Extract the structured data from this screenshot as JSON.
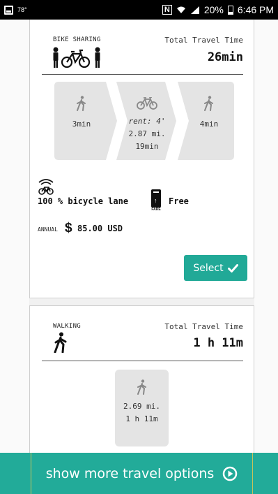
{
  "status_bar": {
    "temperature": "78°",
    "battery_percent": "20%",
    "time": "6:46 PM",
    "nfc_label": "N"
  },
  "bike_option": {
    "mode_label": "BIKE SHARING",
    "total_travel_time_label": "Total Travel Time",
    "total_travel_time": "26min",
    "segments": [
      {
        "icon": "walk-icon",
        "lines": [
          "3min"
        ]
      },
      {
        "icon": "bike-icon",
        "lines": [
          "rent: 4'",
          "2.87 mi.",
          "19min"
        ]
      },
      {
        "icon": "walk-icon",
        "lines": [
          "4min"
        ]
      }
    ],
    "bike_lane_text": "100 % bicycle lane",
    "fare_label": "FARE",
    "fare_text": "Free",
    "annual_label": "ANNUAL",
    "annual_currency": "$",
    "annual_price": "85.00 USD",
    "select_label": "Select"
  },
  "walk_option": {
    "mode_label": "WALKING",
    "total_travel_time_label": "Total Travel Time",
    "total_travel_time": "1 h 11m",
    "segment": {
      "icon": "walk-icon",
      "lines": [
        "2.69 mi.",
        "1 h 11m"
      ]
    }
  },
  "bottom_bar": {
    "label": "show more travel options"
  },
  "colors": {
    "accent": "#21a997",
    "status_bar": "#000000",
    "segment_bg": "#e4e4e4"
  }
}
